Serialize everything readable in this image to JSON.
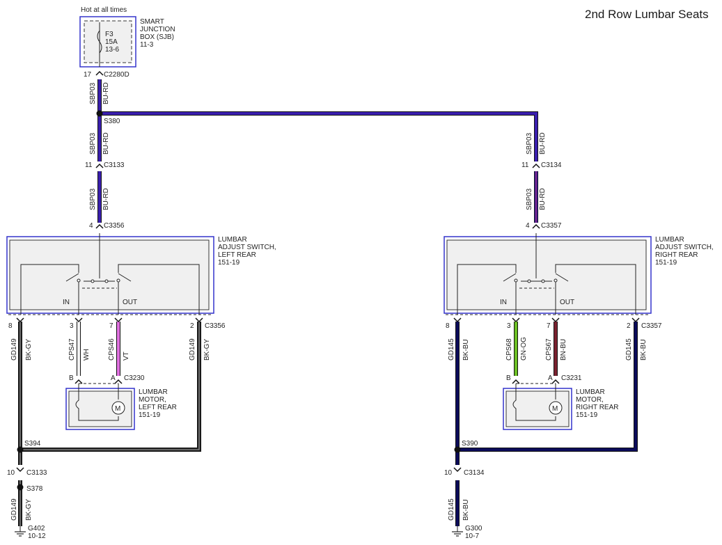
{
  "title": "2nd Row Lumbar Seats",
  "colors": {
    "bu_rd": "#3a1fae",
    "wh": "#f2f2f2",
    "vt": "#e070e0",
    "bk_gy": "#202020",
    "gy": "#909090",
    "bk_bu": "#0c0c5a",
    "gn_og": "#6cc024",
    "bn_bu": "#7a2230",
    "box_blue": "#3333cc",
    "box_fill": "#f0f0f0"
  },
  "sjb": {
    "hot_label": "Hot at all times",
    "fuse": [
      "F3",
      "15A",
      "13-6"
    ],
    "name": [
      "SMART",
      "JUNCTION",
      "BOX (SJB)",
      "11-3"
    ],
    "pin": "17",
    "connector": "C2280D"
  },
  "left": {
    "splice_top": "S380",
    "wire_top": {
      "circuit": "SBP03",
      "color": "BU-RD"
    },
    "wire_mid": {
      "circuit": "SBP03",
      "color": "BU-RD"
    },
    "wire_low": {
      "circuit": "SBP03",
      "color": "BU-RD"
    },
    "c3133_pin": "11",
    "c3133": "C3133",
    "switch_in_pin": "4",
    "switch_conn": "C3356",
    "switch_name": [
      "LUMBAR",
      "ADJUST SWITCH,",
      "LEFT REAR",
      "151-19"
    ],
    "in_label": "IN",
    "out_label": "OUT",
    "pins_bottom": [
      "8",
      "3",
      "7",
      "2"
    ],
    "wire_8": {
      "circuit": "GD149",
      "color": "BK-GY"
    },
    "wire_3": {
      "circuit": "CPS47",
      "color": "WH"
    },
    "wire_7": {
      "circuit": "CPS46",
      "color": "VT"
    },
    "wire_2": {
      "circuit": "GD149",
      "color": "BK-GY"
    },
    "motor_pins": [
      "B",
      "A"
    ],
    "motor_conn": "C3230",
    "motor_name": [
      "LUMBAR",
      "MOTOR,",
      "LEFT REAR",
      "151-19"
    ],
    "motor_symbol": "M",
    "splice_mid": "S394",
    "c3133_low_pin": "10",
    "c3133_low": "C3133",
    "splice_low": "S378",
    "wire_gnd": {
      "circuit": "GD149",
      "color": "BK-GY"
    },
    "ground": [
      "G402",
      "10-12"
    ]
  },
  "right": {
    "wire_top": {
      "circuit": "SBP03",
      "color": "BU-RD"
    },
    "wire_low": {
      "circuit": "SBP03",
      "color": "BU-RD"
    },
    "c3134_pin": "11",
    "c3134": "C3134",
    "switch_in_pin": "4",
    "switch_conn": "C3357",
    "switch_name": [
      "LUMBAR",
      "ADJUST SWITCH,",
      "RIGHT REAR",
      "151-19"
    ],
    "in_label": "IN",
    "out_label": "OUT",
    "pins_bottom": [
      "8",
      "3",
      "7",
      "2"
    ],
    "wire_8": {
      "circuit": "GD145",
      "color": "BK-BU"
    },
    "wire_3": {
      "circuit": "CPS68",
      "color": "GN-OG"
    },
    "wire_7": {
      "circuit": "CPS67",
      "color": "BN-BU"
    },
    "wire_2": {
      "circuit": "GD145",
      "color": "BK-BU"
    },
    "motor_pins": [
      "B",
      "A"
    ],
    "motor_conn": "C3231",
    "motor_name": [
      "LUMBAR",
      "MOTOR,",
      "RIGHT REAR",
      "151-19"
    ],
    "motor_symbol": "M",
    "splice_mid": "S390",
    "c3134_low_pin": "10",
    "c3134_low": "C3134",
    "wire_gnd": {
      "circuit": "GD145",
      "color": "BK-BU"
    },
    "ground": [
      "G300",
      "10-7"
    ]
  }
}
